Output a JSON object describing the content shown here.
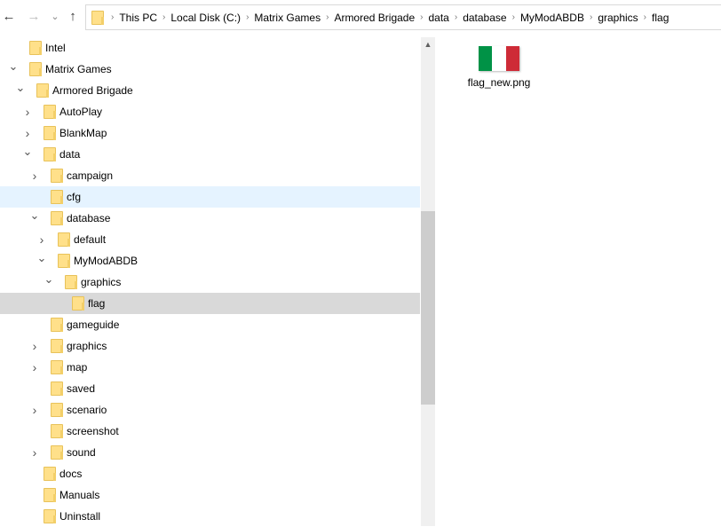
{
  "nav": {
    "back": "←",
    "forward": "→",
    "recent": "⌄",
    "up": "↑"
  },
  "breadcrumb": [
    "This PC",
    "Local Disk (C:)",
    "Matrix Games",
    "Armored Brigade",
    "data",
    "database",
    "MyModABDB",
    "graphics",
    "flag"
  ],
  "tree": [
    {
      "label": "Intel",
      "level": 1,
      "chev": ""
    },
    {
      "label": "Matrix Games",
      "level": 1,
      "chev": "open"
    },
    {
      "label": "Armored Brigade",
      "level": 2,
      "chev": "open"
    },
    {
      "label": "AutoPlay",
      "level": 3,
      "chev": "closed"
    },
    {
      "label": "BlankMap",
      "level": 3,
      "chev": "closed"
    },
    {
      "label": "data",
      "level": 3,
      "chev": "open"
    },
    {
      "label": "campaign",
      "level": 4,
      "chev": "closed"
    },
    {
      "label": "cfg",
      "level": 4,
      "chev": "",
      "state": "hover"
    },
    {
      "label": "database",
      "level": 4,
      "chev": "open"
    },
    {
      "label": "default",
      "level": 5,
      "chev": "closed"
    },
    {
      "label": "MyModABDB",
      "level": 5,
      "chev": "open"
    },
    {
      "label": "graphics",
      "level": 6,
      "chev": "open"
    },
    {
      "label": "flag",
      "level": 7,
      "chev": "",
      "state": "sel"
    },
    {
      "label": "gameguide",
      "level": 4,
      "chev": ""
    },
    {
      "label": "graphics",
      "level": 4,
      "chev": "closed"
    },
    {
      "label": "map",
      "level": 4,
      "chev": "closed"
    },
    {
      "label": "saved",
      "level": 4,
      "chev": ""
    },
    {
      "label": "scenario",
      "level": 4,
      "chev": "closed"
    },
    {
      "label": "screenshot",
      "level": 4,
      "chev": ""
    },
    {
      "label": "sound",
      "level": 4,
      "chev": "closed"
    },
    {
      "label": "docs",
      "level": 3,
      "chev": ""
    },
    {
      "label": "Manuals",
      "level": 3,
      "chev": ""
    },
    {
      "label": "Uninstall",
      "level": 3,
      "chev": ""
    }
  ],
  "files": [
    {
      "name": "flag_new.png",
      "colors": [
        "#009246",
        "#ffffff",
        "#ce2b37"
      ]
    }
  ]
}
